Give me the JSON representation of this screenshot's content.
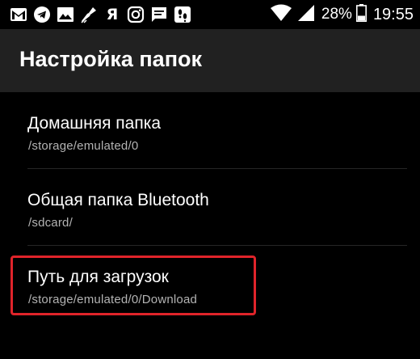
{
  "status_bar": {
    "left_icons": [
      "gmail-icon",
      "telegram-icon",
      "gallery-icon",
      "cleaner-icon",
      "yandex-icon",
      "instagram-icon",
      "message-icon",
      "steps-icon"
    ],
    "yandex_label": "Я",
    "battery_percent": "28%",
    "time": "19:55"
  },
  "action_bar": {
    "title": "Настройка папок"
  },
  "folders": [
    {
      "title": "Домашняя папка",
      "path": "/storage/emulated/0"
    },
    {
      "title": "Общая папка Bluetooth",
      "path": "/sdcard/"
    },
    {
      "title": "Путь для загрузок",
      "path": "/storage/emulated/0/Download"
    }
  ],
  "colors": {
    "background": "#000000",
    "action_bar": "#212121",
    "highlight": "#e0242a",
    "summary_text": "#b3b3b3"
  }
}
